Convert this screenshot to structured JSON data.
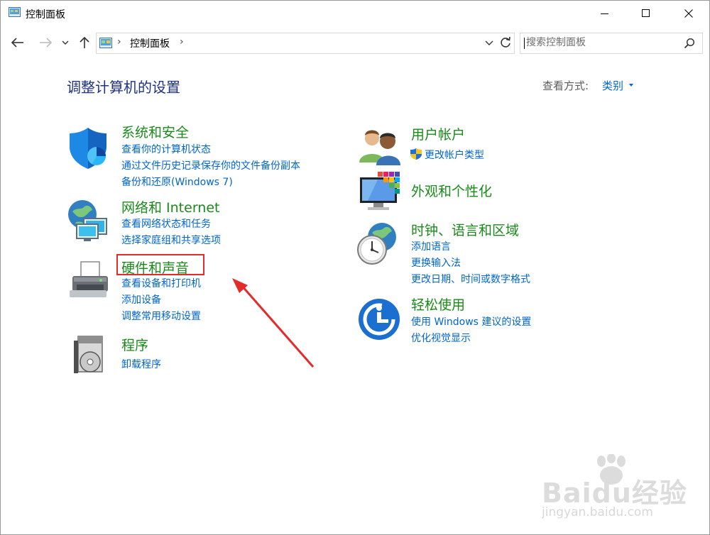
{
  "window": {
    "title": "控制面板",
    "controls": {
      "minimize": "minimize",
      "maximize": "maximize",
      "close": "close"
    }
  },
  "navigation": {
    "breadcrumb": {
      "separator_before": "›",
      "item": "控制面板",
      "separator_after": "›"
    },
    "search_placeholder": "搜索控制面板"
  },
  "header": {
    "title": "调整计算机的设置",
    "view_by_label": "查看方式:",
    "view_by_value": "类别"
  },
  "categories": [
    {
      "title": "系统和安全",
      "icon": "shield-icon",
      "links": [
        "查看你的计算机状态",
        "通过文件历史记录保存你的文件备份副本",
        "备份和还原(Windows 7)"
      ]
    },
    {
      "title": "网络和 Internet",
      "icon": "network-icon",
      "links": [
        "查看网络状态和任务",
        "选择家庭组和共享选项"
      ]
    },
    {
      "title": "硬件和声音",
      "icon": "printer-icon",
      "links": [
        "查看设备和打印机",
        "添加设备",
        "调整常用移动设置"
      ]
    },
    {
      "title": "程序",
      "icon": "programs-icon",
      "links": [
        "卸载程序"
      ]
    },
    {
      "title": "用户帐户",
      "icon": "users-icon",
      "links": [
        "更改帐户类型"
      ],
      "link_icon": "uac-shield-icon"
    },
    {
      "title": "外观和个性化",
      "icon": "display-icon",
      "links": []
    },
    {
      "title": "时钟、语言和区域",
      "icon": "clock-globe-icon",
      "links": [
        "添加语言",
        "更换输入法",
        "更改日期、时间或数字格式"
      ]
    },
    {
      "title": "轻松使用",
      "icon": "ease-of-access-icon",
      "links": [
        "使用 Windows 建议的设置",
        "优化视觉显示"
      ]
    }
  ],
  "annotation": {
    "highlighted_category": "硬件和声音",
    "box_color": "#e52a2a"
  },
  "watermark": {
    "brand": "Baidu经验",
    "url": "jingyan.baidu.com"
  },
  "colors": {
    "category_title": "#1a8a1a",
    "link": "#0066cc",
    "page_title": "#1e3287"
  }
}
